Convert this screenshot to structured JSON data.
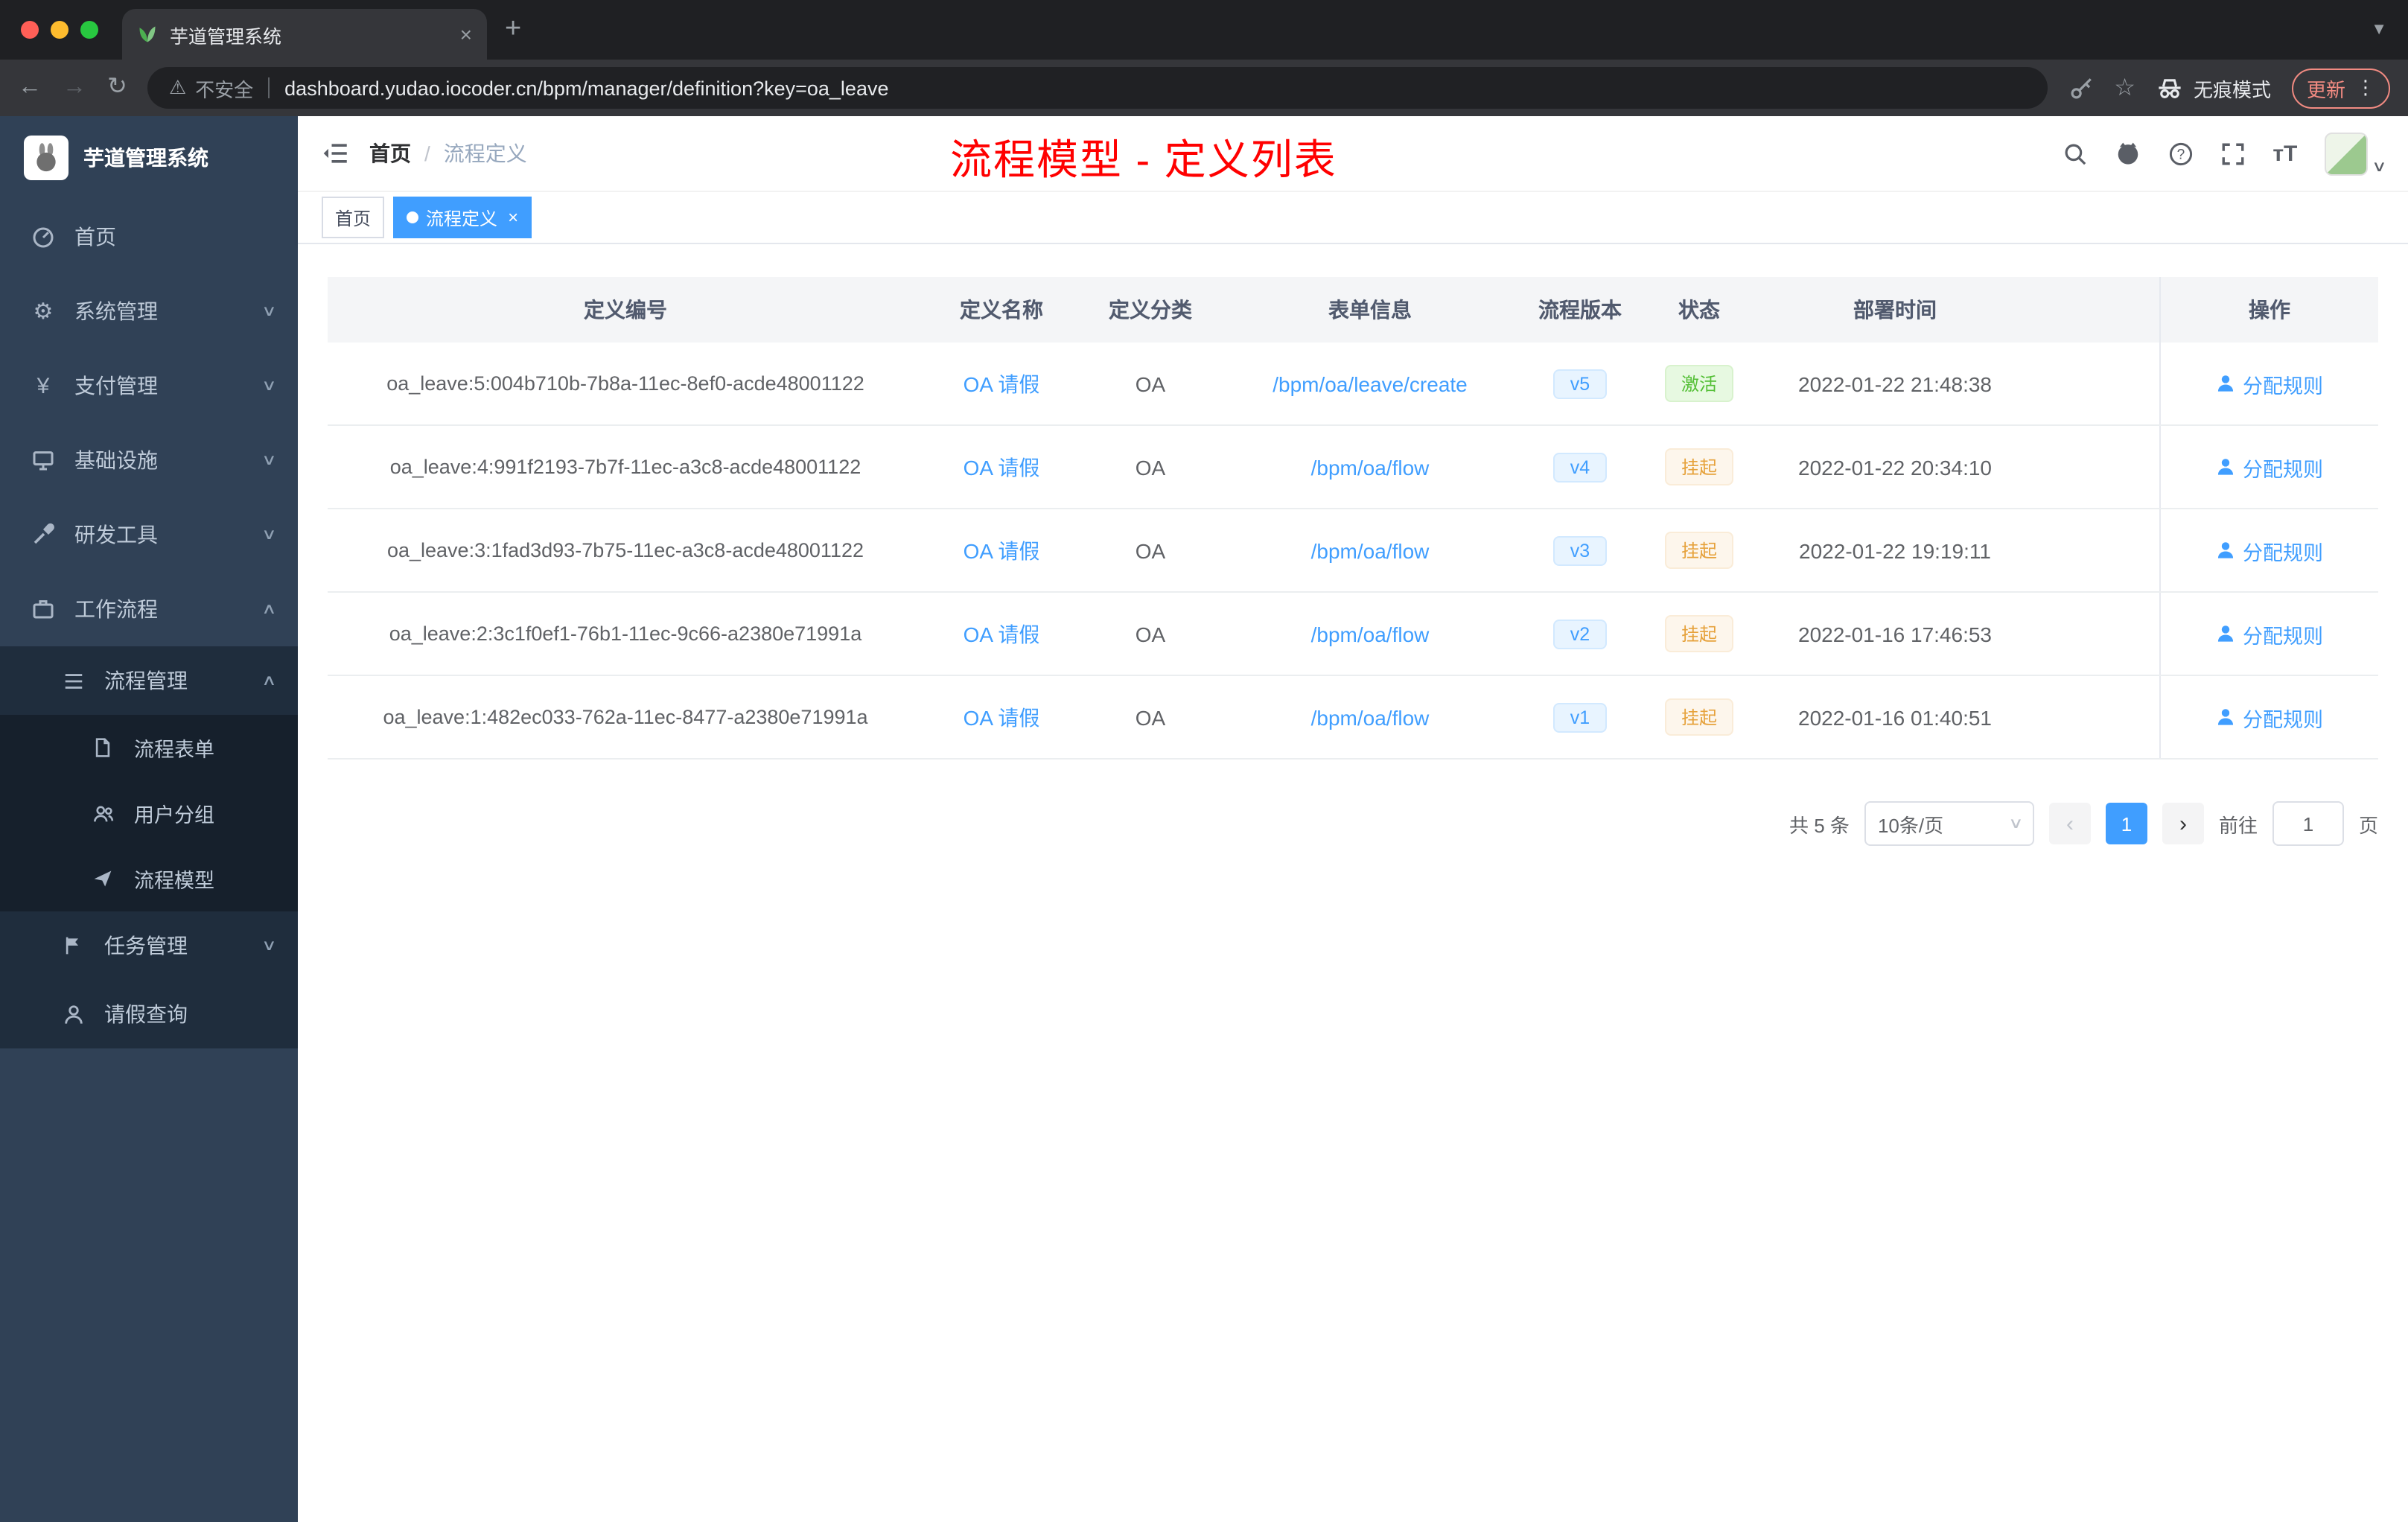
{
  "colors": {
    "accent": "#409eff",
    "annotation": "#ff0000",
    "status_active": "#53bf35",
    "status_suspended": "#e6a23c",
    "sidebar_bg": "#304156"
  },
  "chrome": {
    "tab_title": "芋道管理系统",
    "security_label": "不安全",
    "url": "dashboard.yudao.iocoder.cn/bpm/manager/definition?key=oa_leave",
    "incognito_label": "无痕模式",
    "update_label": "更新"
  },
  "sidebar": {
    "app_title": "芋道管理系统",
    "menu": {
      "home": "首页",
      "system": "系统管理",
      "payment": "支付管理",
      "infrastructure": "基础设施",
      "devtools": "研发工具",
      "workflow": "工作流程",
      "process_mgmt": "流程管理",
      "process_form": "流程表单",
      "user_group": "用户分组",
      "process_model": "流程模型",
      "task_mgmt": "任务管理",
      "leave_query": "请假查询"
    }
  },
  "navbar": {
    "breadcrumb_home": "首页",
    "breadcrumb_separator": "/",
    "breadcrumb_current": "流程定义",
    "annotation": "流程模型 - 定义列表"
  },
  "tags": {
    "home": "首页",
    "active": "流程定义"
  },
  "table": {
    "columns": {
      "id": "定义编号",
      "name": "定义名称",
      "category": "定义分类",
      "form": "表单信息",
      "version": "流程版本",
      "status": "状态",
      "deploy_time": "部署时间",
      "actions": "操作"
    },
    "rows": [
      {
        "id": "oa_leave:5:004b710b-7b8a-11ec-8ef0-acde48001122",
        "name": "OA 请假",
        "category": "OA",
        "form": "/bpm/oa/leave/create",
        "version": "v5",
        "status": "激活",
        "deploy_time": "2022-01-22 21:48:38",
        "action": "分配规则"
      },
      {
        "id": "oa_leave:4:991f2193-7b7f-11ec-a3c8-acde48001122",
        "name": "OA 请假",
        "category": "OA",
        "form": "/bpm/oa/flow",
        "version": "v4",
        "status": "挂起",
        "deploy_time": "2022-01-22 20:34:10",
        "action": "分配规则"
      },
      {
        "id": "oa_leave:3:1fad3d93-7b75-11ec-a3c8-acde48001122",
        "name": "OA 请假",
        "category": "OA",
        "form": "/bpm/oa/flow",
        "version": "v3",
        "status": "挂起",
        "deploy_time": "2022-01-22 19:19:11",
        "action": "分配规则"
      },
      {
        "id": "oa_leave:2:3c1f0ef1-76b1-11ec-9c66-a2380e71991a",
        "name": "OA 请假",
        "category": "OA",
        "form": "/bpm/oa/flow",
        "version": "v2",
        "status": "挂起",
        "deploy_time": "2022-01-16 17:46:53",
        "action": "分配规则"
      },
      {
        "id": "oa_leave:1:482ec033-762a-11ec-8477-a2380e71991a",
        "name": "OA 请假",
        "category": "OA",
        "form": "/bpm/oa/flow",
        "version": "v1",
        "status": "挂起",
        "deploy_time": "2022-01-16 01:40:51",
        "action": "分配规则"
      }
    ]
  },
  "pagination": {
    "total": "共 5 条",
    "page_size": "10条/页",
    "current_page": "1",
    "prev": "‹",
    "next": "›",
    "goto_label": "前往",
    "goto_value": "1",
    "page_unit": "页"
  }
}
